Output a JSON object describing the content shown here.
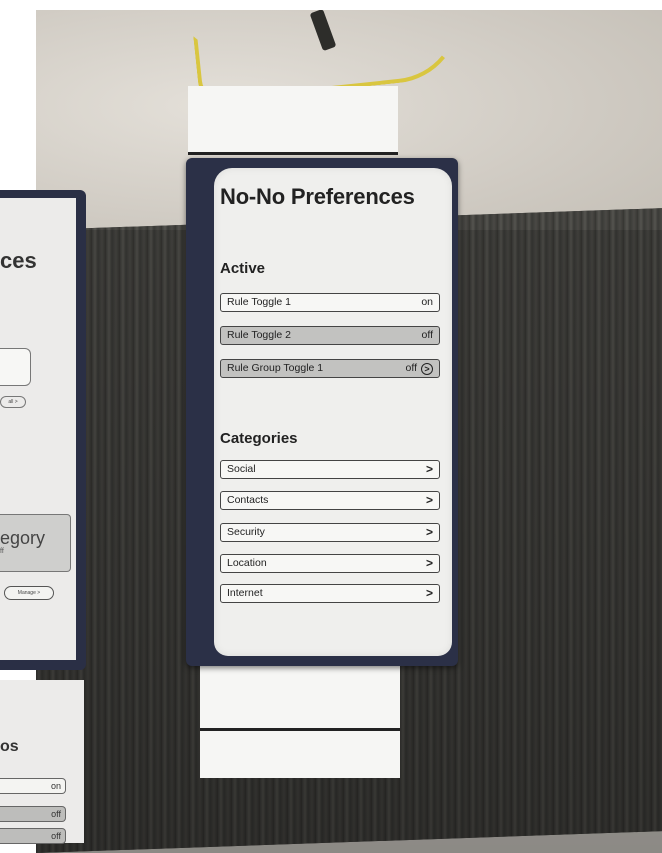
{
  "main_card": {
    "title": "No-No Preferences",
    "active_heading": "Active",
    "active_rules": [
      {
        "label": "Rule Toggle 1",
        "state": "on"
      },
      {
        "label": "Rule Toggle 2",
        "state": "off"
      },
      {
        "label": "Rule Group Toggle 1",
        "state": "off"
      }
    ],
    "categories_heading": "Categories",
    "categories": [
      {
        "label": "Social",
        "chevron": ">"
      },
      {
        "label": "Contacts",
        "chevron": ">"
      },
      {
        "label": "Security",
        "chevron": ">"
      },
      {
        "label": "Location",
        "chevron": ">"
      },
      {
        "label": "Internet",
        "chevron": ">"
      }
    ],
    "group_chevron": ">"
  },
  "left_card": {
    "title_fragment": "ces",
    "pill_text": "all >",
    "category_fragment": "egory",
    "category_sub": "ff",
    "manage_label": "Manage >"
  },
  "left_bottom_card": {
    "title_fragment": "os",
    "rows": [
      "on",
      "off",
      "off"
    ]
  }
}
